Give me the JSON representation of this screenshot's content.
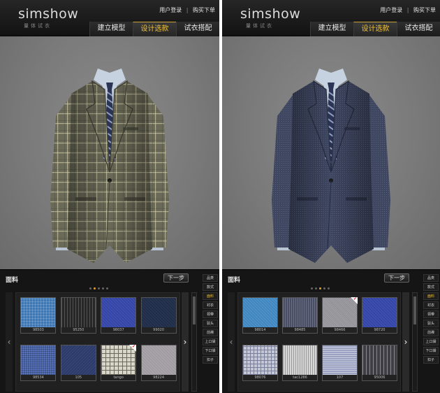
{
  "panels": [
    {
      "logo": "simshow",
      "logo_sub": "量体试衣",
      "links": {
        "login": "用户登录",
        "separator": "|",
        "order": "购买下单"
      },
      "tabs": [
        {
          "label": "建立模型",
          "active": false
        },
        {
          "label": "设计选款",
          "active": true
        },
        {
          "label": "试衣搭配",
          "active": false
        }
      ],
      "suit_style": "plaid",
      "colors": {
        "accent": "#f0c23a",
        "stage": "#7a7a7a",
        "jacket_base": "#6b6a58"
      },
      "fabric": {
        "title": "面料",
        "next_button": "下一步",
        "dots": [
          false,
          true,
          false,
          false,
          false
        ],
        "swatches": [
          {
            "code": "98503",
            "pattern": "blue-check",
            "selected": false
          },
          {
            "code": "95250",
            "pattern": "black-stripe",
            "selected": false
          },
          {
            "code": "98037",
            "pattern": "royal-blue",
            "selected": false
          },
          {
            "code": "99020",
            "pattern": "navy-solid",
            "selected": false
          },
          {
            "code": "98534",
            "pattern": "blue-tweed",
            "selected": false
          },
          {
            "code": "105",
            "pattern": "navy-texture",
            "selected": false
          },
          {
            "code": "tango",
            "pattern": "cream-plaid",
            "selected": true
          },
          {
            "code": "98224",
            "pattern": "grey-texture",
            "selected": false
          }
        ]
      },
      "side_menu": [
        "品类",
        "款式",
        "面料",
        "衬衣",
        "领带",
        "驳头",
        "前襟",
        "上口袋",
        "下口袋",
        "扣子"
      ],
      "side_active_index": 2
    },
    {
      "logo": "simshow",
      "logo_sub": "量体试衣",
      "links": {
        "login": "用户登录",
        "separator": "|",
        "order": "购买下单"
      },
      "tabs": [
        {
          "label": "建立模型",
          "active": false
        },
        {
          "label": "设计选款",
          "active": true
        },
        {
          "label": "试衣搭配",
          "active": false
        }
      ],
      "suit_style": "navy",
      "colors": {
        "accent": "#f0c23a",
        "stage": "#7a7a7a",
        "jacket_base": "#3e4660"
      },
      "fabric": {
        "title": "面料",
        "next_button": "下一步",
        "dots": [
          false,
          false,
          true,
          false,
          false
        ],
        "swatches": [
          {
            "code": "98014",
            "pattern": "sky-blue",
            "selected": false
          },
          {
            "code": "98485",
            "pattern": "slate-stripe",
            "selected": false
          },
          {
            "code": "98466",
            "pattern": "grey-melange",
            "selected": true
          },
          {
            "code": "98720",
            "pattern": "royal-blue",
            "selected": false
          },
          {
            "code": "98076",
            "pattern": "light-check",
            "selected": false
          },
          {
            "code": "tac1286",
            "pattern": "white-stripe",
            "selected": false
          },
          {
            "code": "107",
            "pattern": "lavender-stripe",
            "selected": false
          },
          {
            "code": "95006",
            "pattern": "dark-pinstripe",
            "selected": false
          }
        ]
      },
      "side_menu": [
        "品类",
        "款式",
        "面料",
        "衬衣",
        "领带",
        "驳头",
        "前襟",
        "上口袋",
        "下口袋",
        "扣子"
      ],
      "side_active_index": 2
    }
  ]
}
